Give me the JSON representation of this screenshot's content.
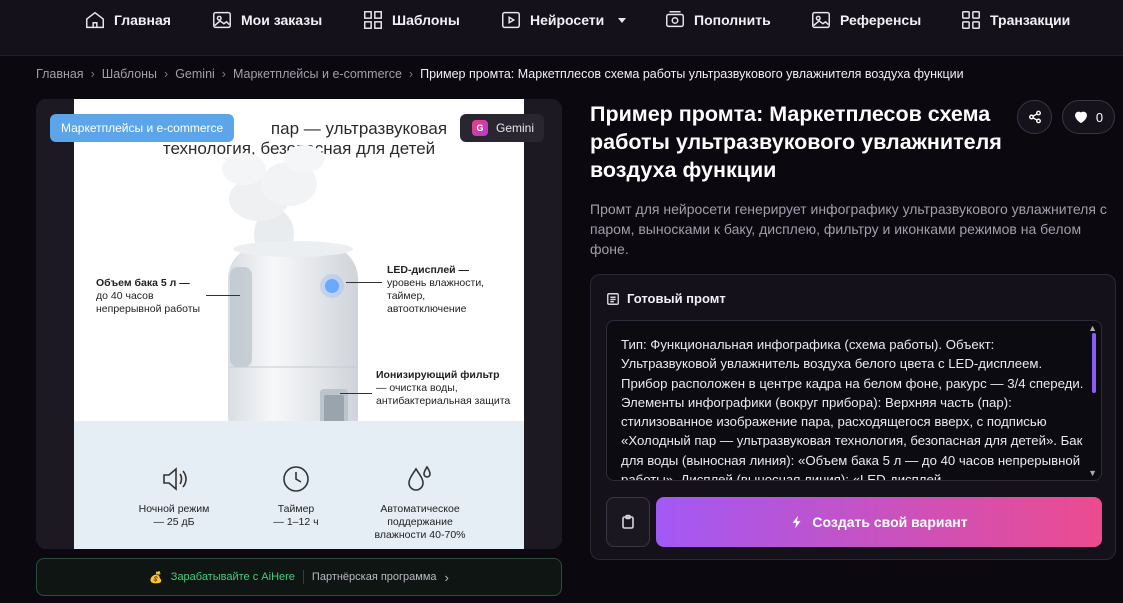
{
  "nav": {
    "items": [
      {
        "label": "Главная",
        "icon": "home-icon"
      },
      {
        "label": "Мои заказы",
        "icon": "image-icon"
      },
      {
        "label": "Шаблоны",
        "icon": "grid-icon"
      },
      {
        "label": "Нейросети",
        "icon": "play-icon"
      },
      {
        "label": "Пополнить",
        "icon": "wallet-icon"
      },
      {
        "label": "Референсы",
        "icon": "image-icon"
      },
      {
        "label": "Транзакции",
        "icon": "grid-icon"
      }
    ]
  },
  "breadcrumb": {
    "items": [
      "Главная",
      "Шаблоны",
      "Gemini",
      "Маркетплейсы и e-commerce"
    ],
    "current": "Пример промта: Маркетплесов схема работы ультразвукового увлажнителя воздуха функции"
  },
  "card": {
    "category_badge": "Маркетплейсы и e-commerce",
    "model_badge": "Gemini",
    "model_letter": "G"
  },
  "infographic": {
    "title_line1": "пар — ультразвуковая",
    "title_line2": "технология, безопасная для детей",
    "left_callout": {
      "bold": "Объем бака 5 л —",
      "rest1": "до 40 часов",
      "rest2": "непрерывной работы"
    },
    "right_callout": {
      "bold": "LED-дисплей —",
      "rest1": "уровень влажности,",
      "rest2": "таймер,",
      "rest3": "автоотключение"
    },
    "filter_callout": {
      "bold": "Ионизирующий фильтр",
      "rest1": "— очистка воды,",
      "rest2": "антибактериальная защита"
    },
    "features": [
      {
        "line1": "Ночной режим",
        "line2": "— 25 дБ",
        "line3": ""
      },
      {
        "line1": "Таймер",
        "line2": "— 1–12 ч",
        "line3": ""
      },
      {
        "line1": "Автоматическое",
        "line2": "поддержание",
        "line3": "влажности 40-70%"
      }
    ]
  },
  "earn": {
    "coin": "💰",
    "earn_text": "Зарабатывайте с AiHere",
    "partner_text": "Партнёрская программа"
  },
  "detail": {
    "title": "Пример промта: Маркетплесов схема работы ультразвукового увлажнителя воздуха функции",
    "likes": "0",
    "description": "Промт для нейросети генерирует инфографику ультразвукового увлажнителя с паром, выносками к баку, дисплею, фильтру и иконками режимов на белом фоне."
  },
  "prompt": {
    "heading": "Готовый промт",
    "text": "Тип: Функциональная инфографика (схема работы). Объект: Ультразвуковой увлажнитель воздуха белого цвета с LED-дисплеем. Прибор расположен в центре кадра на белом фоне, ракурс — 3/4 спереди. Элементы инфографики (вокруг прибора): Верхняя часть (пар): стилизованное изображение пара, расходящегося вверх, с подписью «Холодный пар — ультразвуковая технология, безопасная для детей». Бак для воды (выносная линия): «Объем бака 5 л — до 40 часов непрерывной работы». Дисплей (выносная линия): «LED-дисплей —",
    "create_label": "Создать свой вариант"
  }
}
